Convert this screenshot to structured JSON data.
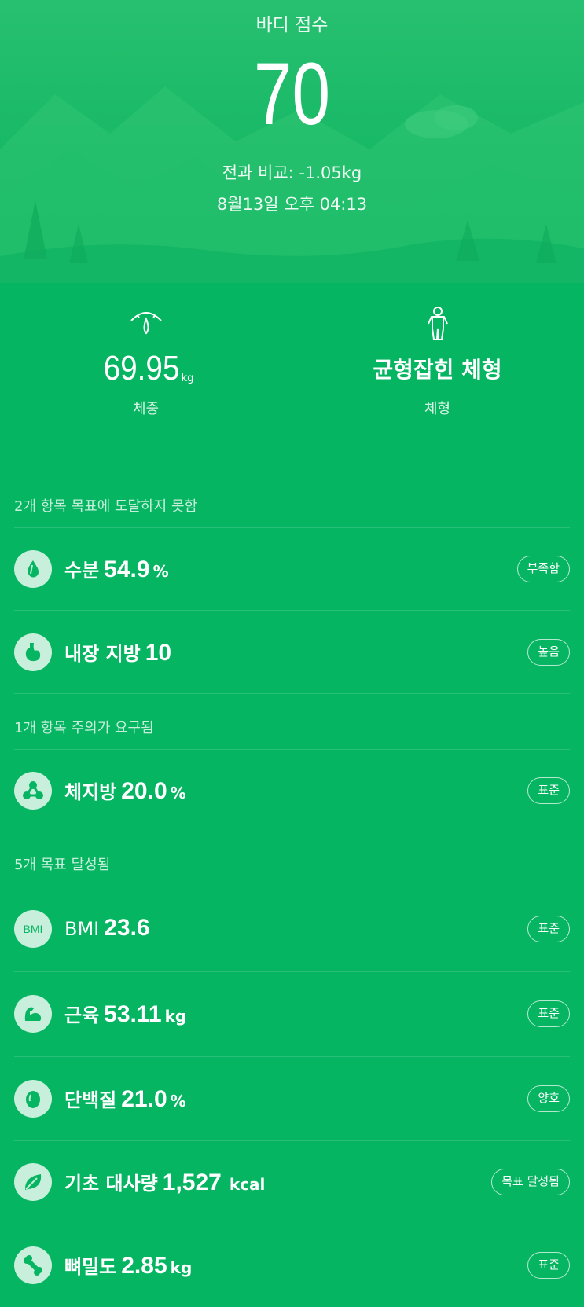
{
  "header": {
    "title": "바디 점수",
    "score": "70",
    "comparison": "전과 비교: -1.05kg",
    "datetime": "8월13일 오후 04:13"
  },
  "stats": {
    "weight_value": "69.95",
    "weight_unit": "kg",
    "weight_caption": "체중",
    "body_type_value": "균형잡힌 체형",
    "body_type_caption": "체형"
  },
  "sections": {
    "unmet": "2개 항목 목표에 도달하지 못함",
    "attention": "1개 항목 주의가 요구됨",
    "achieved": "5개 목표 달성됨"
  },
  "metrics": [
    {
      "name": "수분",
      "value": "54.9",
      "unit": "%",
      "status": "부족함",
      "icon": "water-drop-icon"
    },
    {
      "name": "내장 지방",
      "value": "10",
      "unit": "",
      "status": "높음",
      "icon": "stomach-icon"
    },
    {
      "name": "체지방",
      "value": "20.0",
      "unit": "%",
      "status": "표준",
      "icon": "molecule-icon"
    },
    {
      "name": "BMI",
      "value": "23.6",
      "unit": "",
      "status": "표준",
      "icon": "bmi-icon",
      "icon_text": "BMI"
    },
    {
      "name": "근육",
      "value": "53.11",
      "unit": "kg",
      "status": "표준",
      "icon": "muscle-arm-icon"
    },
    {
      "name": "단백질",
      "value": "21.0",
      "unit": "%",
      "status": "양호",
      "icon": "egg-icon"
    },
    {
      "name": "기초 대사량",
      "value": "1,527",
      "unit": "kcal",
      "status": "목표 달성됨",
      "icon": "leaf-icon"
    },
    {
      "name": "뼈밀도",
      "value": "2.85",
      "unit": "kg",
      "status": "표준",
      "icon": "bone-icon"
    }
  ]
}
